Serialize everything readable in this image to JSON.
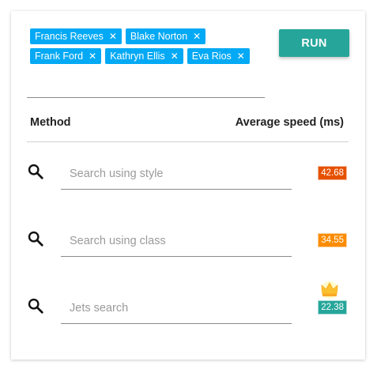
{
  "chips": [
    {
      "label": "Francis Reeves"
    },
    {
      "label": "Blake Norton"
    },
    {
      "label": "Frank Ford"
    },
    {
      "label": "Kathryn Ellis"
    },
    {
      "label": "Eva Rios"
    }
  ],
  "chip_remove_glyph": "✕",
  "run_label": "RUN",
  "table": {
    "method_header": "Method",
    "speed_header": "Average speed (ms)"
  },
  "rows": [
    {
      "placeholder": "Search using style",
      "speed": "42.68",
      "badge_color": "#e65100"
    },
    {
      "placeholder": "Search using class",
      "speed": "34.55",
      "badge_color": "#fb8c00"
    },
    {
      "placeholder": "Jets search",
      "speed": "22.38",
      "badge_color": "#26a69a",
      "winner": true
    }
  ],
  "colors": {
    "chip": "#03a9f4",
    "run_button": "#26a69a",
    "crown": "#fbc02d"
  }
}
